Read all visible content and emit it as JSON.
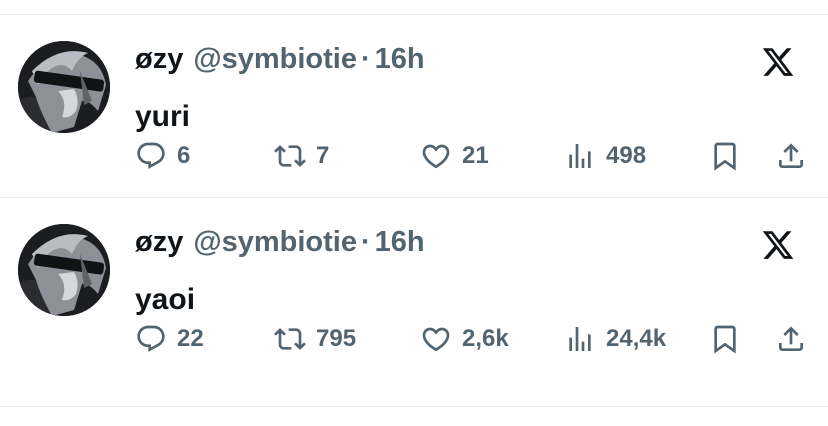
{
  "tweets": [
    {
      "display_name": "øzy",
      "handle": "@symbiotie",
      "separator": "·",
      "time": "16h",
      "text": "yuri",
      "replies": "6",
      "retweets": "7",
      "likes": "21",
      "views": "498",
      "avatar_icon": "user-avatar",
      "platform_icon": "x-logo-icon"
    },
    {
      "display_name": "øzy",
      "handle": "@symbiotie",
      "separator": "·",
      "time": "16h",
      "text": "yaoi",
      "replies": "22",
      "retweets": "795",
      "likes": "2,6k",
      "views": "24,4k",
      "avatar_icon": "user-avatar",
      "platform_icon": "x-logo-icon"
    }
  ],
  "colors": {
    "text_primary": "#0f1419",
    "text_secondary": "#536471",
    "divider": "#e6e9ec",
    "background": "#ffffff"
  }
}
